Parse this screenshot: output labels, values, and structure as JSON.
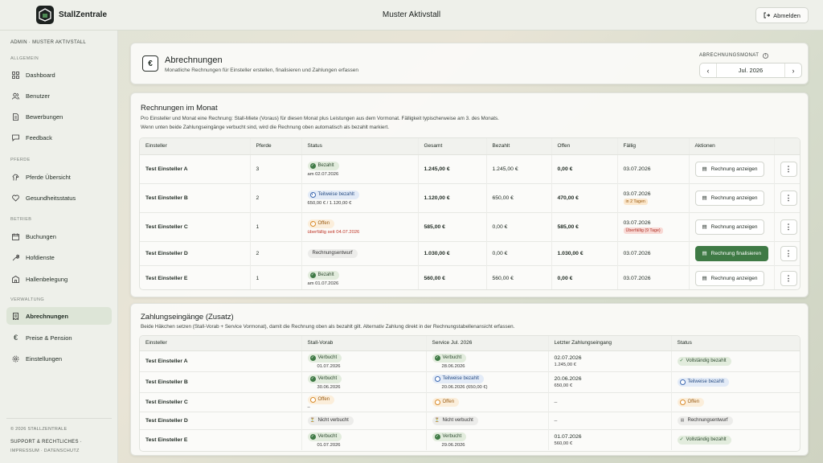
{
  "header": {
    "brand": "StallZentrale",
    "stable_name": "Muster Aktivstall",
    "logout_label": "Abmelden"
  },
  "sidebar": {
    "user_line": "ADMIN · MUSTER AKTIVSTALL",
    "sections": [
      {
        "label": "ALLGEMEIN",
        "items": [
          {
            "label": "Dashboard",
            "icon": "grid-icon"
          },
          {
            "label": "Benutzer",
            "icon": "users-icon"
          },
          {
            "label": "Bewerbungen",
            "icon": "document-icon"
          },
          {
            "label": "Feedback",
            "icon": "chat-icon"
          }
        ]
      },
      {
        "label": "PFERDE",
        "items": [
          {
            "label": "Pferde Übersicht",
            "icon": "horse-icon"
          },
          {
            "label": "Gesundheitsstatus",
            "icon": "heart-icon"
          }
        ]
      },
      {
        "label": "BETRIEB",
        "items": [
          {
            "label": "Buchungen",
            "icon": "calendar-icon"
          },
          {
            "label": "Hofdienste",
            "icon": "wrench-icon"
          },
          {
            "label": "Hallenbelegung",
            "icon": "building-icon"
          }
        ]
      },
      {
        "label": "VERWALTUNG",
        "items": [
          {
            "label": "Abrechnungen",
            "icon": "invoice-icon",
            "active": true
          },
          {
            "label": "Preise & Pension",
            "icon": "euro-icon"
          },
          {
            "label": "Einstellungen",
            "icon": "gear-icon"
          }
        ]
      }
    ],
    "copyright": "© 2026 STALLZENTRALE",
    "support": "SUPPORT & RECHTLICHES ·",
    "links": "IMPRESSUM · DATENSCHUTZ"
  },
  "page": {
    "icon_glyph": "€",
    "title": "Abrechnungen",
    "subtitle": "Monatliche Rechnungen für Einsteller erstellen, finalisieren und Zahlungen erfassen",
    "month_label": "ABRECHNUNGSMONAT",
    "month_value": "Jul. 2026"
  },
  "invoices": {
    "title": "Rechnungen im Monat",
    "desc1": "Pro Einsteller und Monat eine Rechnung: Stall-Miete (Voraus) für diesen Monat plus Leistungen aus dem Vormonat. Fälligkeit typischerweise am 3. des Monats.",
    "desc2": "Wenn unten beide Zahlungseingänge verbucht sind, wird die Rechnung oben automatisch als bezahlt markiert.",
    "columns": [
      "Einsteller",
      "Pferde",
      "Status",
      "Gesamt",
      "Bezahlt",
      "Offen",
      "Fällig",
      "Aktionen"
    ],
    "rows": [
      {
        "name": "Test Einsteller A",
        "horses": "3",
        "status": "Bezahlt",
        "status_sub": "am 02.07.2026",
        "total": "1.245,00 €",
        "paid": "1.245,00 €",
        "open": "0,00 €",
        "due": "03.07.2026",
        "due_note": "",
        "action": "Rechnung anzeigen"
      },
      {
        "name": "Test Einsteller B",
        "horses": "2",
        "status": "Teilweise bezahlt",
        "status_sub": "650,00 € / 1.120,00 €",
        "total": "1.120,00 €",
        "paid": "650,00 €",
        "open": "470,00 €",
        "due": "03.07.2026",
        "due_note": "in 2 Tagen",
        "action": "Rechnung anzeigen"
      },
      {
        "name": "Test Einsteller C",
        "horses": "1",
        "status": "Offen",
        "status_sub": "überfällig seit 04.07.2026",
        "total": "585,00 €",
        "paid": "0,00 €",
        "open": "585,00 €",
        "due": "03.07.2026",
        "due_note": "Überfällig (9 Tage)",
        "action": "Rechnung anzeigen"
      },
      {
        "name": "Test Einsteller D",
        "horses": "2",
        "status": "Rechnungsentwurf",
        "status_sub": "",
        "total": "1.030,00 €",
        "paid": "0,00 €",
        "open": "1.030,00 €",
        "due": "03.07.2026",
        "due_note": "",
        "action": "Rechnung finalisieren"
      },
      {
        "name": "Test Einsteller E",
        "horses": "1",
        "status": "Bezahlt",
        "status_sub": "am 01.07.2026",
        "total": "560,00 €",
        "paid": "560,00 €",
        "open": "0,00 €",
        "due": "03.07.2026",
        "due_note": "",
        "action": "Rechnung anzeigen"
      }
    ]
  },
  "payments": {
    "title": "Zahlungseingänge (Zusatz)",
    "desc": "Beide Häkchen setzen (Stall-Vorab + Service Vormonat), damit die Rechnung oben als bezahlt gilt. Alternativ Zahlung direkt in der Rechnungstabellenansicht erfassen.",
    "columns": [
      "Einsteller",
      "Stall-Vorab",
      "Service Jul. 2026",
      "Letzter Zahlungseingang",
      "Status"
    ],
    "rows": [
      {
        "name": "Test Einsteller A",
        "stall": "Verbucht",
        "stall_date": "01.07.2026",
        "service": "Verbucht",
        "service_date": "28.06.2026",
        "last_date": "02.07.2026",
        "last_amount": "1.245,00 €",
        "status": "Vollständig bezahlt"
      },
      {
        "name": "Test Einsteller B",
        "stall": "Verbucht",
        "stall_date": "30.06.2026",
        "service": "Teilweise bezahlt",
        "service_date": "20.06.2026 (650,00 €)",
        "last_date": "20.06.2026",
        "last_amount": "650,00 €",
        "status": "Teilweise bezahlt"
      },
      {
        "name": "Test Einsteller C",
        "stall": "Offen",
        "stall_date": "–",
        "service": "Offen",
        "service_date": "",
        "last_date": "–",
        "last_amount": "",
        "status": "Offen"
      },
      {
        "name": "Test Einsteller D",
        "stall": "Nicht verbucht",
        "stall_date": "",
        "service": "Nicht verbucht",
        "service_date": "",
        "last_date": "–",
        "last_amount": "",
        "status": "Rechnungsentwurf"
      },
      {
        "name": "Test Einsteller E",
        "stall": "Verbucht",
        "stall_date": "01.07.2026",
        "service": "Verbucht",
        "service_date": "29.06.2026",
        "last_date": "01.07.2026",
        "last_amount": "560,00 €",
        "status": "Vollständig bezahlt"
      }
    ]
  },
  "colors": {
    "accent": "#3f7a45",
    "paid": "#e2ecdd",
    "partial": "#e3ebf7",
    "open": "#fbeedb",
    "overdue": "#c0392b"
  }
}
